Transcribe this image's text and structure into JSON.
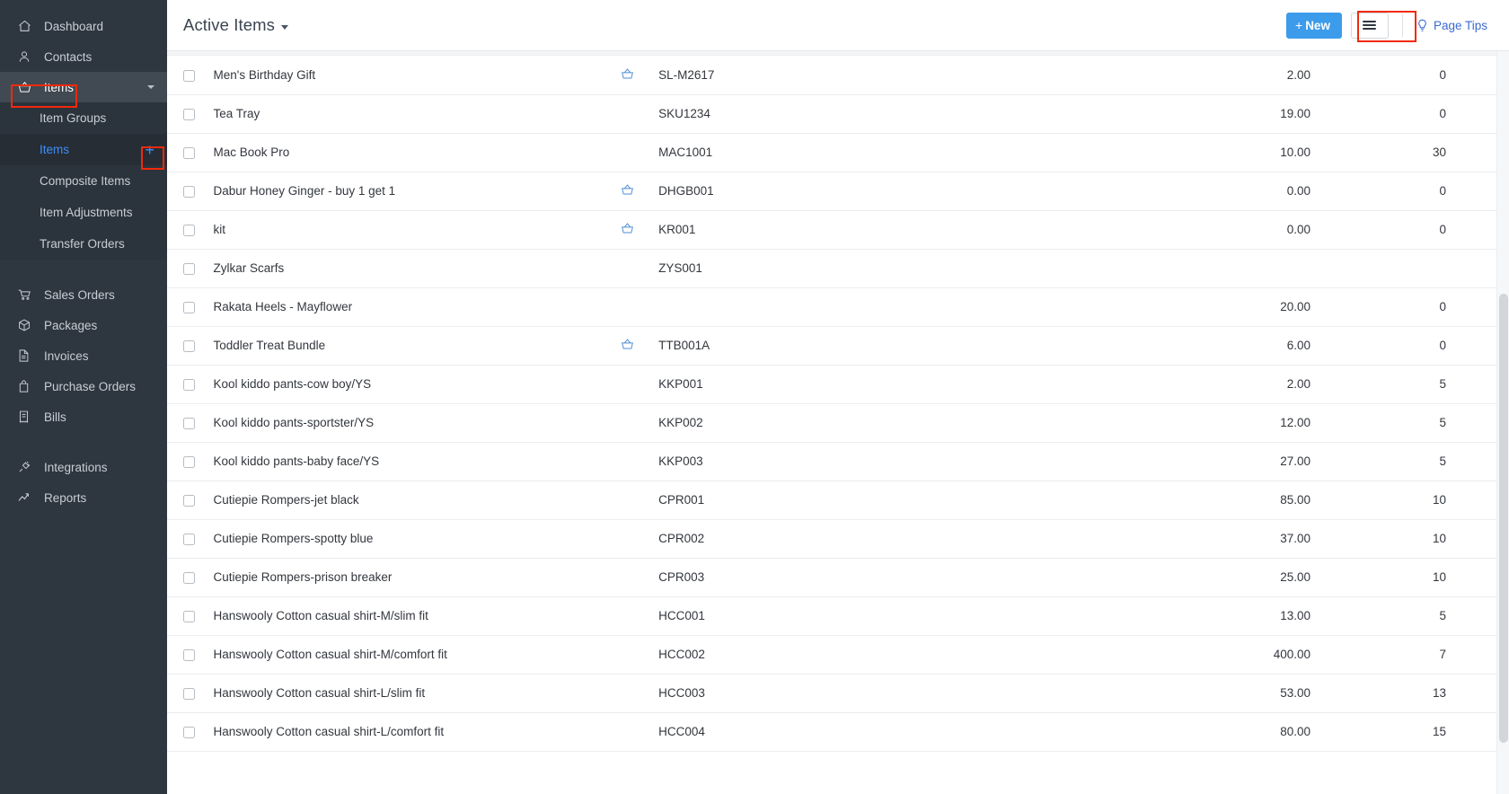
{
  "sidebar": {
    "items": [
      {
        "label": "Dashboard",
        "icon": "home-icon"
      },
      {
        "label": "Contacts",
        "icon": "user-icon"
      },
      {
        "label": "Items",
        "icon": "basket-icon",
        "active": true,
        "caret": true
      }
    ],
    "sub_items": [
      {
        "label": "Item Groups"
      },
      {
        "label": "Items",
        "selected": true,
        "plus": "+"
      },
      {
        "label": "Composite Items"
      },
      {
        "label": "Item Adjustments"
      },
      {
        "label": "Transfer Orders"
      }
    ],
    "items_lower": [
      {
        "label": "Sales Orders",
        "icon": "cart-icon"
      },
      {
        "label": "Packages",
        "icon": "box-icon"
      },
      {
        "label": "Invoices",
        "icon": "invoice-icon"
      },
      {
        "label": "Purchase Orders",
        "icon": "bag-icon"
      },
      {
        "label": "Bills",
        "icon": "bill-icon"
      }
    ],
    "items_footer": [
      {
        "label": "Integrations",
        "icon": "plug-icon"
      },
      {
        "label": "Reports",
        "icon": "chart-icon"
      }
    ]
  },
  "header": {
    "title": "Active Items",
    "new_button": "New",
    "new_button_plus": "+",
    "page_tips": "Page Tips"
  },
  "table": {
    "rows": [
      {
        "name": "Men's Birthday Gift",
        "bundle": true,
        "sku": "SL-M2617",
        "rate": "2.00",
        "stock": "0"
      },
      {
        "name": "Tea Tray",
        "bundle": false,
        "sku": "SKU1234",
        "rate": "19.00",
        "stock": "0"
      },
      {
        "name": "Mac Book Pro",
        "bundle": false,
        "sku": "MAC1001",
        "rate": "10.00",
        "stock": "30"
      },
      {
        "name": "Dabur Honey Ginger - buy 1 get 1",
        "bundle": true,
        "sku": "DHGB001",
        "rate": "0.00",
        "stock": "0"
      },
      {
        "name": "kit",
        "bundle": true,
        "sku": "KR001",
        "rate": "0.00",
        "stock": "0"
      },
      {
        "name": "Zylkar Scarfs",
        "bundle": false,
        "sku": "ZYS001",
        "rate": "",
        "stock": ""
      },
      {
        "name": "Rakata Heels - Mayflower",
        "bundle": false,
        "sku": "",
        "rate": "20.00",
        "stock": "0"
      },
      {
        "name": "Toddler Treat Bundle",
        "bundle": true,
        "sku": "TTB001A",
        "rate": "6.00",
        "stock": "0"
      },
      {
        "name": "Kool kiddo pants-cow boy/YS",
        "bundle": false,
        "sku": "KKP001",
        "rate": "2.00",
        "stock": "5"
      },
      {
        "name": "Kool kiddo pants-sportster/YS",
        "bundle": false,
        "sku": "KKP002",
        "rate": "12.00",
        "stock": "5"
      },
      {
        "name": "Kool kiddo pants-baby face/YS",
        "bundle": false,
        "sku": "KKP003",
        "rate": "27.00",
        "stock": "5"
      },
      {
        "name": "Cutiepie Rompers-jet black",
        "bundle": false,
        "sku": "CPR001",
        "rate": "85.00",
        "stock": "10"
      },
      {
        "name": "Cutiepie Rompers-spotty blue",
        "bundle": false,
        "sku": "CPR002",
        "rate": "37.00",
        "stock": "10"
      },
      {
        "name": "Cutiepie Rompers-prison breaker",
        "bundle": false,
        "sku": "CPR003",
        "rate": "25.00",
        "stock": "10"
      },
      {
        "name": "Hanswooly Cotton casual shirt-M/slim fit",
        "bundle": false,
        "sku": "HCC001",
        "rate": "13.00",
        "stock": "5"
      },
      {
        "name": "Hanswooly Cotton casual shirt-M/comfort fit",
        "bundle": false,
        "sku": "HCC002",
        "rate": "400.00",
        "stock": "7"
      },
      {
        "name": "Hanswooly Cotton casual shirt-L/slim fit",
        "bundle": false,
        "sku": "HCC003",
        "rate": "53.00",
        "stock": "13"
      },
      {
        "name": "Hanswooly Cotton casual shirt-L/comfort fit",
        "bundle": false,
        "sku": "HCC004",
        "rate": "80.00",
        "stock": "15"
      }
    ]
  },
  "colors": {
    "sidebar_bg": "#2e3640",
    "accent_blue": "#3c9ceb",
    "link_blue": "#3d8ef7",
    "annotation_red": "#f3290b"
  }
}
